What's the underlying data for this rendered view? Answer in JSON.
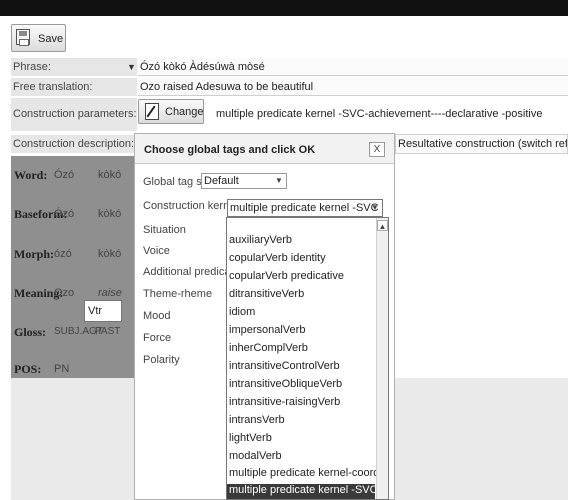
{
  "toolbar": {
    "save_label": "Save"
  },
  "phrase": {
    "label": "Phrase:",
    "value": "Ózó kòkó Àdésúwà mòsé"
  },
  "free_translation": {
    "label": "Free translation:",
    "value": "Ozo raised Adesuwa to be beautiful"
  },
  "construction_parameters": {
    "label": "Construction parameters:",
    "change_label": "Change",
    "value": "multiple predicate kernel -SVC-achievement----declarative -positive"
  },
  "construction_description": {
    "label": "Construction description:",
    "value": "Resultative construction (switch reference))"
  },
  "gloss_grid": {
    "rows": [
      {
        "header": "Word:",
        "c1": "Ózó",
        "c2": "kòkó"
      },
      {
        "header": "Baseform:",
        "c1": "Ózó",
        "c2": "kòkó"
      },
      {
        "header": "Morph:",
        "c1": "ózó",
        "c2": "kòkó"
      },
      {
        "header": "Meaning:",
        "c1": "Ozo",
        "c2": "raise"
      },
      {
        "header": "Gloss:",
        "c1": "SUBJ.AGT",
        "c2": "PAST"
      },
      {
        "header": "POS:",
        "c1": "PN",
        "c2": "Vtr"
      }
    ]
  },
  "dialog": {
    "title": "Choose global tags and click OK",
    "close_label": "X",
    "tagset_label": "Global tag set:",
    "tagset_value": "Default",
    "kernel_label": "Construction kernel",
    "kernel_value": "multiple predicate kernel -SVC",
    "fields": [
      "Situation",
      "Voice",
      "Additional predicates",
      "Theme-rheme",
      "Mood",
      "Force",
      "Polarity"
    ]
  },
  "dropdown": {
    "options": [
      "auxiliaryVerb",
      "copularVerb identity",
      "copularVerb predicative",
      "ditransitiveVerb",
      "idiom",
      "impersonalVerb",
      "inherComplVerb",
      "intransitiveControlVerb",
      "intransitiveObliqueVerb",
      "intransitive-raisingVerb",
      "intransVerb",
      "lightVerb",
      "modalVerb",
      "multiple predicate kernel-coordination"
    ],
    "selected": "multiple predicate kernel -SVC"
  }
}
